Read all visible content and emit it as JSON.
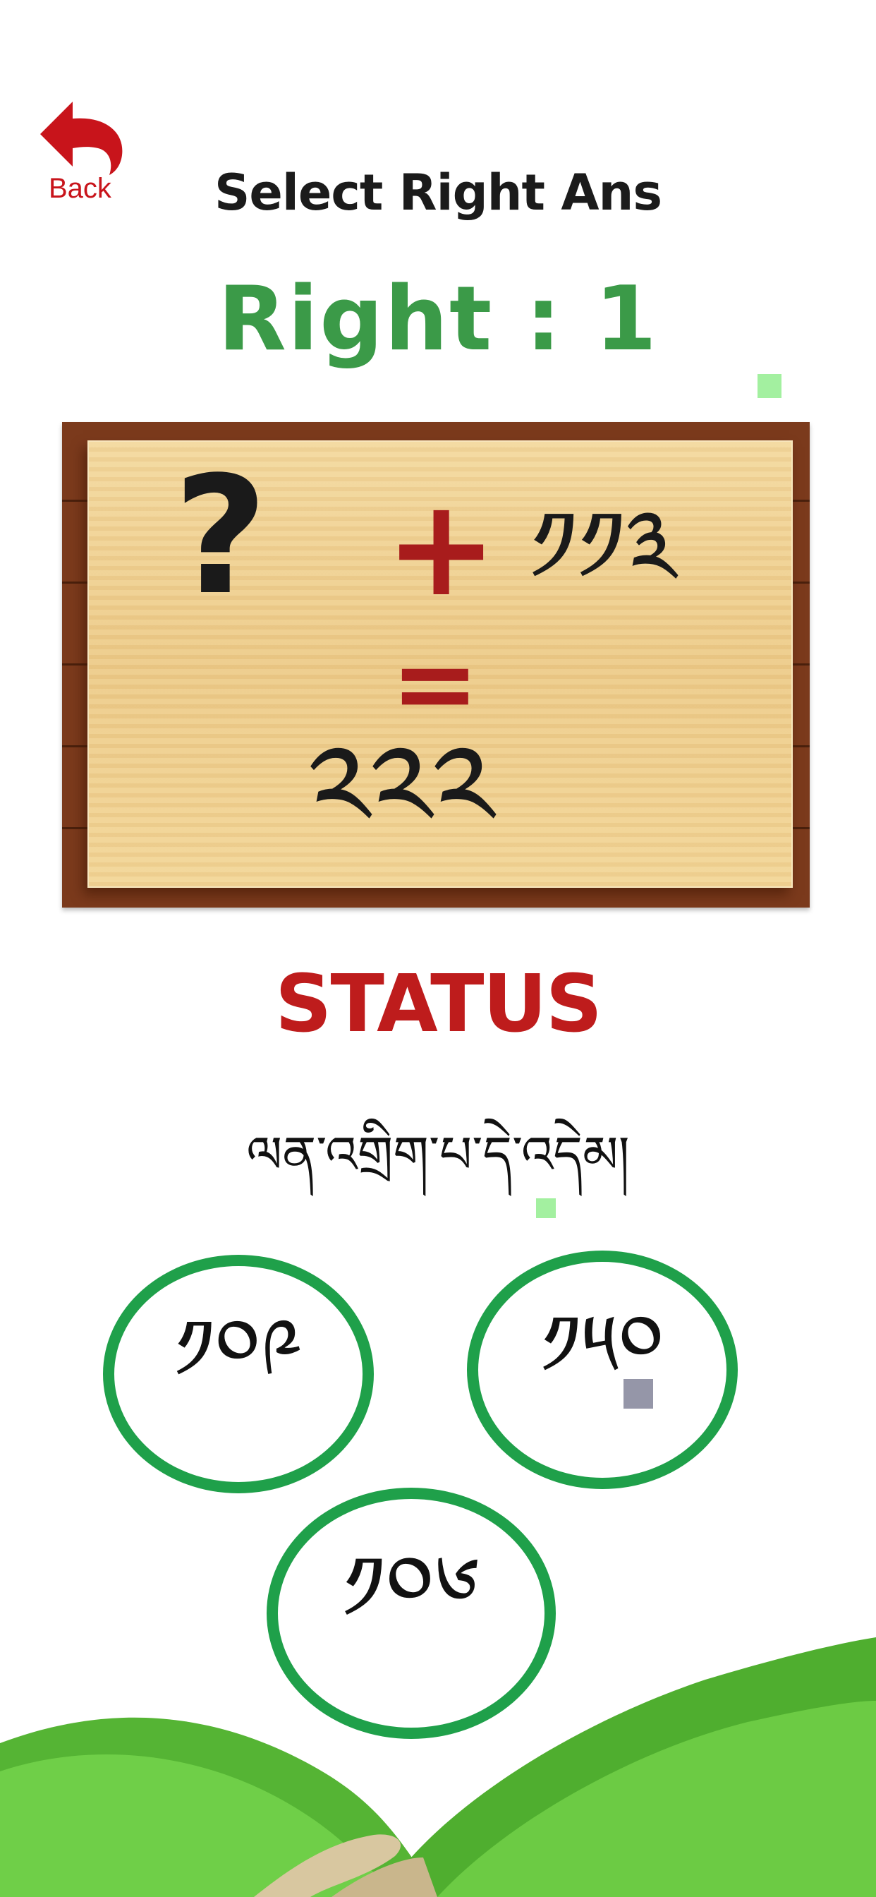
{
  "nav": {
    "back_label": "Back",
    "back_icon": "back-arrow-icon",
    "accent": "#c8141b"
  },
  "header": {
    "title": "Select Right Ans"
  },
  "score": {
    "text": "Right : 1",
    "color": "#3b9a48"
  },
  "question": {
    "operand_unknown": "?",
    "operator": "+",
    "operand_known": "༡༡༣",
    "equals": "=",
    "result": "༢༢༢"
  },
  "status": {
    "title": "STATUS",
    "message": "ལན་འགྲིག་པ་དེ་འདེམ།",
    "title_color": "#be1c1c"
  },
  "choices": [
    {
      "label": "༡༠༩"
    },
    {
      "label": "༡༥༠"
    },
    {
      "label": "༡༠༦"
    }
  ],
  "colors": {
    "choice_ring": "#1fa04a",
    "board_frame": "#7b3a1c",
    "board_wood": "#eccb8a"
  }
}
